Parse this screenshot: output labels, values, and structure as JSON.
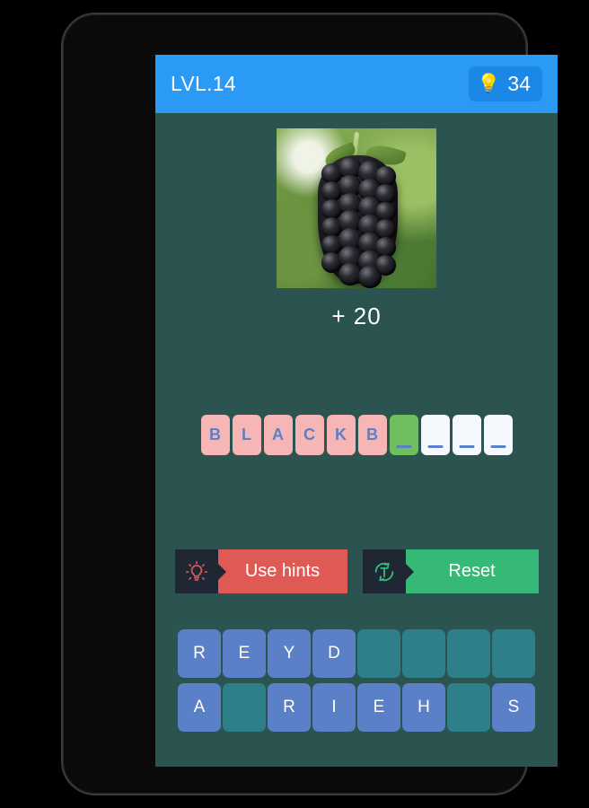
{
  "header": {
    "level_label": "LVL.14",
    "hint_icon": "lightbulb-icon",
    "hint_glyph": "💡",
    "hint_count": "34",
    "background_color": "#2b9af4",
    "badge_color": "#1b87e6"
  },
  "puzzle": {
    "image_alt": "blackberry-photo",
    "score_text": "+ 20"
  },
  "answer": {
    "slots": [
      {
        "letter": "B",
        "state": "filled"
      },
      {
        "letter": "L",
        "state": "filled"
      },
      {
        "letter": "A",
        "state": "filled"
      },
      {
        "letter": "C",
        "state": "filled"
      },
      {
        "letter": "K",
        "state": "filled"
      },
      {
        "letter": "B",
        "state": "filled"
      },
      {
        "letter": "",
        "state": "active"
      },
      {
        "letter": "",
        "state": "empty"
      },
      {
        "letter": "",
        "state": "empty"
      },
      {
        "letter": "",
        "state": "empty"
      }
    ],
    "filled_color": "#f7b6b6",
    "active_color": "#6fbf5e",
    "empty_color": "#f5f9fd",
    "letter_color": "#5a80c8"
  },
  "actions": {
    "use_hints": {
      "label": "Use hints",
      "icon": "lightbulb-icon",
      "color": "#e05a55"
    },
    "reset": {
      "label": "Reset",
      "icon": "reset-circular-arrow-icon",
      "color": "#36b877"
    },
    "icon_panel_color": "#1e2733"
  },
  "keyboard": {
    "key_color": "#5a80c8",
    "used_key_color": "#2d7f8a",
    "rows": [
      [
        {
          "letter": "R",
          "state": "available"
        },
        {
          "letter": "E",
          "state": "available"
        },
        {
          "letter": "Y",
          "state": "available"
        },
        {
          "letter": "D",
          "state": "available"
        },
        {
          "letter": "",
          "state": "used"
        },
        {
          "letter": "",
          "state": "used"
        },
        {
          "letter": "",
          "state": "used"
        },
        {
          "letter": "",
          "state": "used"
        }
      ],
      [
        {
          "letter": "A",
          "state": "available"
        },
        {
          "letter": "",
          "state": "used"
        },
        {
          "letter": "R",
          "state": "available"
        },
        {
          "letter": "I",
          "state": "available"
        },
        {
          "letter": "E",
          "state": "available"
        },
        {
          "letter": "H",
          "state": "available"
        },
        {
          "letter": "",
          "state": "used"
        },
        {
          "letter": "S",
          "state": "available"
        }
      ]
    ]
  },
  "screen": {
    "background_color": "#2b5450"
  }
}
